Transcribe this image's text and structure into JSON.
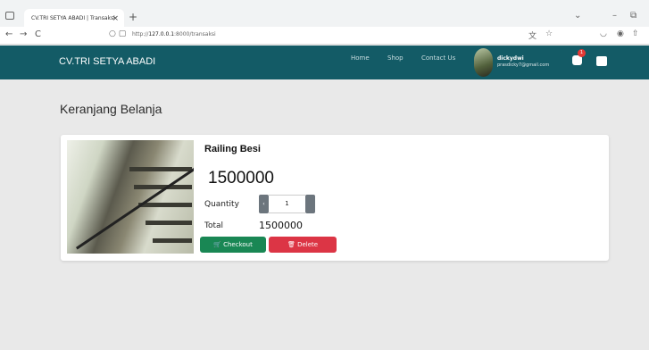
{
  "browser": {
    "tab_title": "CV.TRI SETYA ABADI | Transaksi",
    "tab_close": "×",
    "new_tab": "+",
    "url_prefix": "http://",
    "url_host": "127.0.0.1",
    "url_rest": ":8000/transaksi",
    "back": "←",
    "forward": "→",
    "reload": "C"
  },
  "navbar": {
    "brand": "CV.TRI SETYA ABADI",
    "links": [
      "Home",
      "Shop",
      "Contact Us"
    ],
    "user_name": "dickydwi",
    "user_email": "prasdicky7@gmail.com",
    "cart_count": "1"
  },
  "page": {
    "title": "Keranjang Belanja"
  },
  "cart_item": {
    "name": "Railing Besi",
    "price": "1500000",
    "quantity_label": "Quantity",
    "quantity_value": "1",
    "total_label": "Total",
    "total_value": "1500000",
    "checkout_label": "Checkout",
    "delete_label": "Delete"
  },
  "colors": {
    "navbar": "#135b66",
    "checkout": "#198754",
    "delete": "#dc3545"
  }
}
